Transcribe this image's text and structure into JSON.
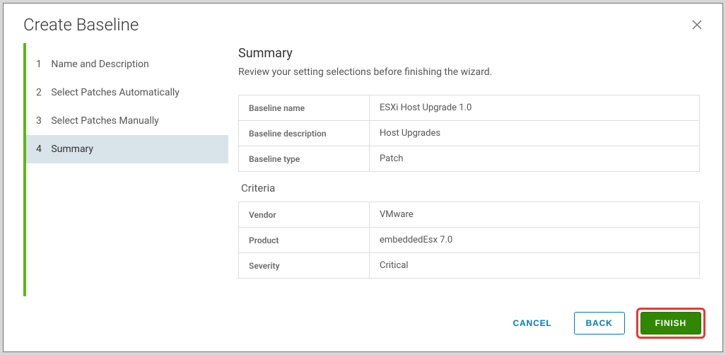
{
  "modal": {
    "title": "Create Baseline"
  },
  "steps": [
    {
      "num": "1",
      "label": "Name and Description"
    },
    {
      "num": "2",
      "label": "Select Patches Automatically"
    },
    {
      "num": "3",
      "label": "Select Patches Manually"
    },
    {
      "num": "4",
      "label": "Summary"
    }
  ],
  "summary": {
    "heading": "Summary",
    "subheading": "Review your setting selections before finishing the wizard.",
    "baseline": {
      "name_label": "Baseline name",
      "name_value": "ESXi Host Upgrade 1.0",
      "desc_label": "Baseline description",
      "desc_value": "Host Upgrades",
      "type_label": "Baseline type",
      "type_value": "Patch"
    },
    "criteria_heading": "Criteria",
    "criteria": {
      "vendor_label": "Vendor",
      "vendor_value": "VMware",
      "product_label": "Product",
      "product_value": "embeddedEsx 7.0",
      "severity_label": "Severity",
      "severity_value": "Critical"
    }
  },
  "footer": {
    "cancel": "CANCEL",
    "back": "BACK",
    "finish": "FINISH"
  }
}
